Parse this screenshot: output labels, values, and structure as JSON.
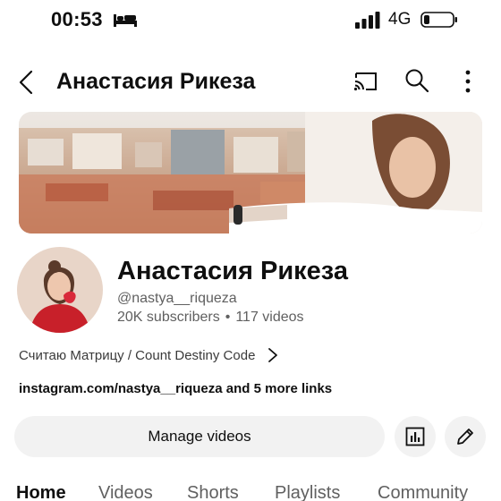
{
  "status_bar": {
    "time": "00:53",
    "network": "4G",
    "icons": [
      "bed-icon",
      "signal-icon",
      "battery-icon"
    ]
  },
  "top_bar": {
    "title": "Анастасия Рикеза",
    "icons": [
      "back-icon",
      "cast-icon",
      "search-icon",
      "more-vertical-icon"
    ]
  },
  "channel": {
    "name": "Анастасия Рикеза",
    "handle": "@nastya__riqueza",
    "subscribers": "20K subscribers",
    "separator": "•",
    "videos": "117 videos",
    "description": "Считаю Матрицу / Count Destiny Code",
    "link_main": "instagram.com/nastya__riqueza",
    "link_more": "and 5 more links"
  },
  "actions": {
    "manage_label": "Manage videos",
    "icons": [
      "analytics-icon",
      "edit-icon"
    ]
  },
  "tabs": [
    "Home",
    "Videos",
    "Shorts",
    "Playlists",
    "Community"
  ],
  "active_tab": "Home",
  "colors": {
    "text": "#0f0f0f",
    "secondary_text": "#606060",
    "button_bg": "#f2f2f2",
    "avatar_bg": "#e8d5c8",
    "avatar_shirt": "#c8202a"
  }
}
